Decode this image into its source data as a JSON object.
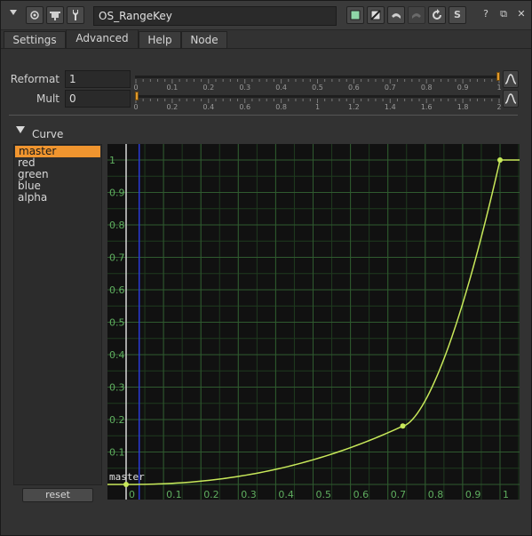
{
  "titlebar": {
    "node_name": "OS_RangeKey",
    "icons": [
      "collapse-arrow-icon",
      "node-view-icon",
      "center-node-icon",
      "settings-wrench-icon",
      "color-swatch-icon",
      "clear-icon",
      "undo-icon",
      "redo-icon",
      "revert-icon",
      "script-icon",
      "help-icon",
      "float-window-icon",
      "close-icon"
    ],
    "help_label": "?",
    "close_label": "✕",
    "float_label": "⧉",
    "script_label": "S"
  },
  "tabs": [
    "Settings",
    "Advanced",
    "Help",
    "Node"
  ],
  "active_tab": "Advanced",
  "knobs": {
    "reformat": {
      "label": "Reformat",
      "value": "1",
      "ticks": [
        "0",
        "0.1",
        "0.2",
        "0.3",
        "0.4",
        "0.5",
        "0.6",
        "0.7",
        "0.8",
        "0.9",
        "1"
      ],
      "range": [
        0,
        1
      ]
    },
    "mult": {
      "label": "Mult",
      "value": "0",
      "ticks": [
        "0",
        "0.2",
        "0.4",
        "0.6",
        "0.8",
        "1",
        "1.2",
        "1.4",
        "1.6",
        "1.8",
        "2"
      ],
      "range": [
        0,
        2
      ]
    }
  },
  "curve_section": {
    "title": "Curve",
    "channels": [
      "master",
      "red",
      "green",
      "blue",
      "alpha"
    ],
    "selected_channel": "master",
    "reset_label": "reset",
    "curve_label": "master",
    "x_ticks": [
      "0",
      "0.1",
      "0.2",
      "0.3",
      "0.4",
      "0.5",
      "0.6",
      "0.7",
      "0.8",
      "0.9",
      "1"
    ],
    "y_ticks": [
      "0.1",
      "0.2",
      "0.3",
      "0.4",
      "0.5",
      "0.6",
      "0.7",
      "0.8",
      "0.9",
      "1"
    ],
    "keyframes": [
      [
        0,
        0
      ],
      [
        0.74,
        0.18
      ],
      [
        1,
        1
      ]
    ],
    "curve_color": "#c8e85a",
    "grid_color": "#1f3a1f",
    "grid_major_color": "#2f5a2f",
    "tick_color": "#5fae5f",
    "current_frame_x": 0.035
  },
  "colors": {
    "accent": "#f0952f",
    "panel_bg": "#323232"
  }
}
